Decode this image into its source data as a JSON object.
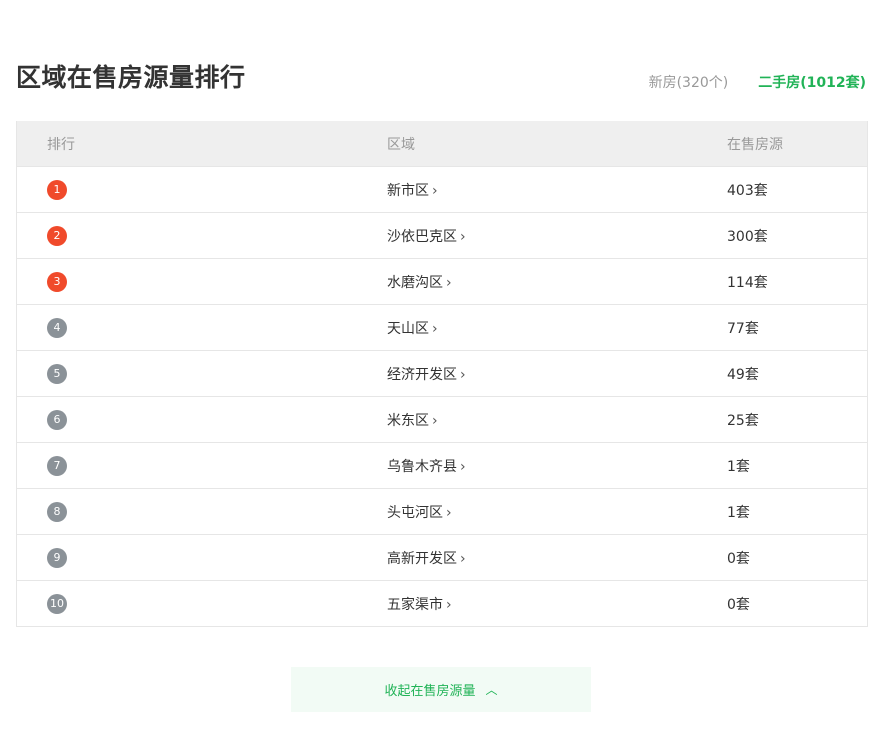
{
  "title": "区域在售房源量排行",
  "tabs": {
    "new": "新房(320个)",
    "second": "二手房(1012套)"
  },
  "table": {
    "headers": {
      "rank": "排行",
      "region": "区域",
      "count": "在售房源"
    },
    "rows": [
      {
        "rank": "1",
        "region": "新市区",
        "count": "403套",
        "highlight": true
      },
      {
        "rank": "2",
        "region": "沙依巴克区",
        "count": "300套",
        "highlight": true
      },
      {
        "rank": "3",
        "region": "水磨沟区",
        "count": "114套",
        "highlight": true
      },
      {
        "rank": "4",
        "region": "天山区",
        "count": "77套",
        "highlight": false
      },
      {
        "rank": "5",
        "region": "经济开发区",
        "count": "49套",
        "highlight": false
      },
      {
        "rank": "6",
        "region": "米东区",
        "count": "25套",
        "highlight": false
      },
      {
        "rank": "7",
        "region": "乌鲁木齐县",
        "count": "1套",
        "highlight": false
      },
      {
        "rank": "8",
        "region": "头屯河区",
        "count": "1套",
        "highlight": false
      },
      {
        "rank": "9",
        "region": "高新开发区",
        "count": "0套",
        "highlight": false
      },
      {
        "rank": "10",
        "region": "五家渠市",
        "count": "0套",
        "highlight": false
      }
    ]
  },
  "collapse_label": "收起在售房源量",
  "colors": {
    "accent_green": "#21b357",
    "rank_top": "#f04a2b",
    "rank_other": "#8b9298"
  }
}
